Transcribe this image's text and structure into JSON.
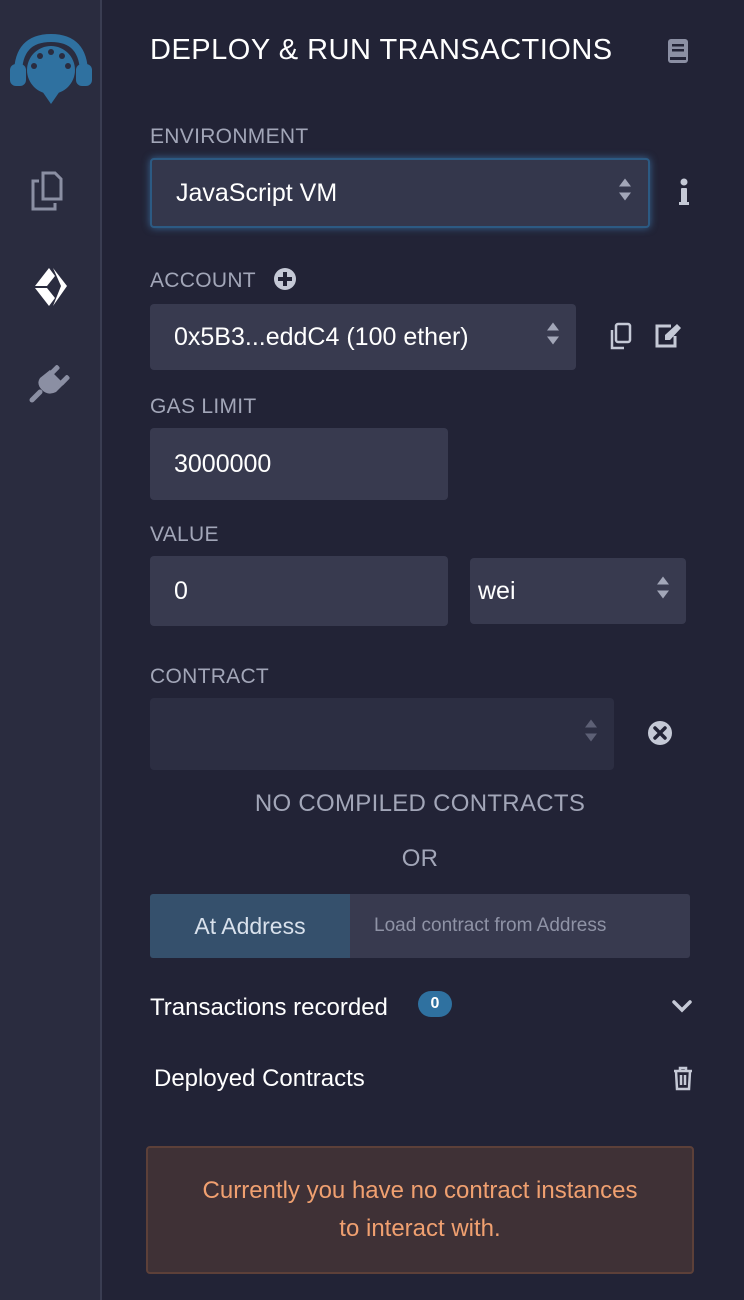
{
  "header": {
    "title": "DEPLOY & RUN TRANSACTIONS"
  },
  "sidebar": {
    "icons": [
      "remix-logo-icon",
      "file-explorer-icon",
      "deploy-run-icon",
      "plugin-manager-icon"
    ]
  },
  "environment": {
    "label": "ENVIRONMENT",
    "value": "JavaScript VM"
  },
  "account": {
    "label": "ACCOUNT",
    "value": "0x5B3...eddC4 (100 ether)"
  },
  "gas_limit": {
    "label": "GAS LIMIT",
    "value": "3000000"
  },
  "value": {
    "label": "VALUE",
    "amount": "0",
    "unit": "wei"
  },
  "contract": {
    "label": "CONTRACT",
    "value": "",
    "no_compiled": "NO COMPILED CONTRACTS",
    "or": "OR"
  },
  "at_address": {
    "button": "At Address",
    "placeholder": "Load contract from Address"
  },
  "transactions": {
    "label": "Transactions recorded",
    "count": "0"
  },
  "deployed": {
    "label": "Deployed Contracts",
    "empty_message_line1": "Currently you have no contract instances",
    "empty_message_line2": "to interact with."
  },
  "colors": {
    "background": "#222336",
    "field": "#383a4f",
    "accent": "#2f71a0",
    "warning_text": "#f0a070"
  }
}
